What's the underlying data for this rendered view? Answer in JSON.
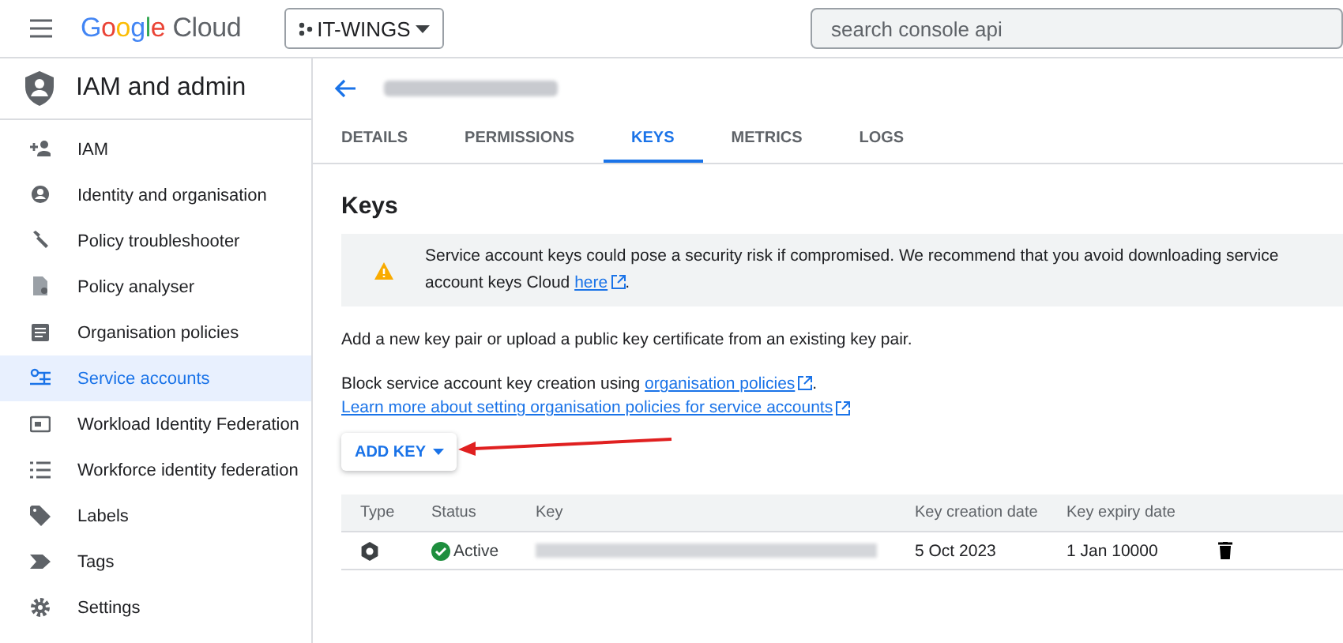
{
  "topbar": {
    "logo_word": "Google",
    "logo_product": "Cloud",
    "project": "IT-WINGS",
    "search": {
      "placeholder": "search console api"
    }
  },
  "sidebar": {
    "title": "IAM and admin",
    "items": [
      {
        "label": "IAM",
        "selected": false
      },
      {
        "label": "Identity and organisation",
        "selected": false
      },
      {
        "label": "Policy troubleshooter",
        "selected": false
      },
      {
        "label": "Policy analyser",
        "selected": false
      },
      {
        "label": "Organisation policies",
        "selected": false
      },
      {
        "label": "Service accounts",
        "selected": true
      },
      {
        "label": "Workload Identity Federation",
        "selected": false
      },
      {
        "label": "Workforce identity federation",
        "selected": false
      },
      {
        "label": "Labels",
        "selected": false
      },
      {
        "label": "Tags",
        "selected": false
      },
      {
        "label": "Settings",
        "selected": false
      }
    ]
  },
  "tabs": [
    {
      "label": "DETAILS",
      "selected": false
    },
    {
      "label": "PERMISSIONS",
      "selected": false
    },
    {
      "label": "KEYS",
      "selected": true
    },
    {
      "label": "METRICS",
      "selected": false
    },
    {
      "label": "LOGS",
      "selected": false
    }
  ],
  "heading": "Keys",
  "warning": {
    "line1": "Service account keys could pose a security risk if compromised. We recommend that you avoid downloading service account keys",
    "line2": "Cloud",
    "link": "here",
    "end": "."
  },
  "intro": "Add a new key pair or upload a public key certificate from an existing key pair.",
  "block_text": "Block service account key creation using",
  "block_link": "organisation policies",
  "block_end": ".",
  "learn_link": "Learn more about setting organisation policies for service accounts",
  "add_key": "ADD KEY",
  "table": {
    "columns": [
      "Type",
      "Status",
      "Key",
      "Key creation date",
      "Key expiry date"
    ],
    "rows": [
      {
        "status": "Active",
        "created": "5 Oct 2023",
        "expires": "1 Jan 10000"
      }
    ]
  }
}
